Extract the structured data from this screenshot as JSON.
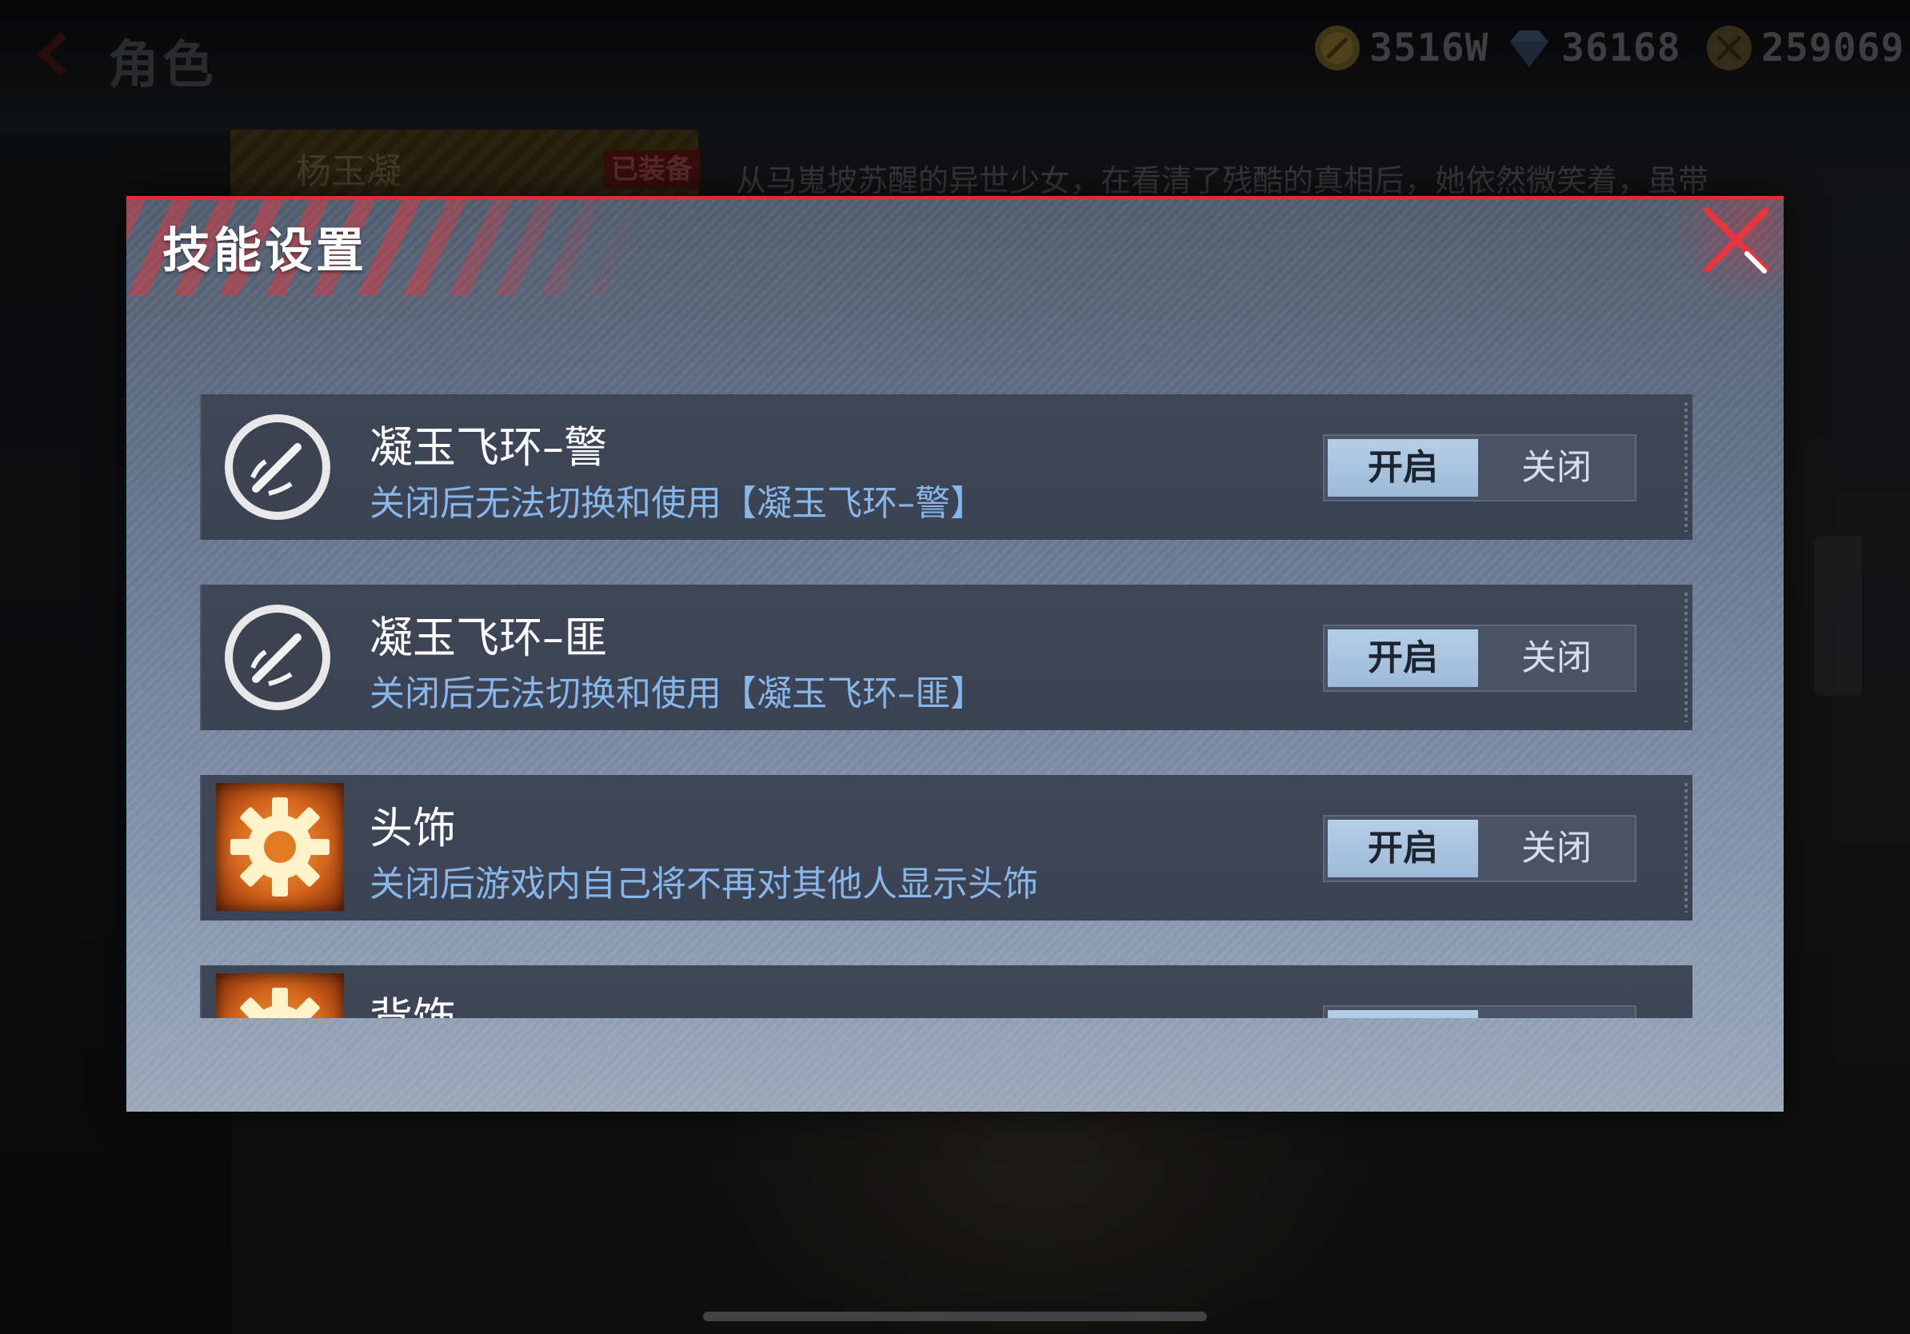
{
  "topbar": {
    "title": "角色",
    "currencies": [
      {
        "icon": "gold-coin-icon",
        "value": "3516W"
      },
      {
        "icon": "diamond-icon",
        "value": "36168"
      },
      {
        "icon": "medal-coin-icon",
        "value": "259069"
      }
    ]
  },
  "background": {
    "character_name": "杨玉凝",
    "equipped_badge": "已装备",
    "character_desc": "从马嵬坡苏醒的异世少女，在看清了残酷的真相后，她依然微笑着，虽带"
  },
  "modal": {
    "title": "技能设置",
    "skills": [
      {
        "name": "凝玉飞环–警",
        "desc": "关闭后无法切换和使用【凝玉飞环–警】",
        "icon": "dagger-skill-icon",
        "on_label": "开启",
        "off_label": "关闭",
        "state": "on"
      },
      {
        "name": "凝玉飞环–匪",
        "desc": "关闭后无法切换和使用【凝玉飞环–匪】",
        "icon": "dagger-skill-icon",
        "on_label": "开启",
        "off_label": "关闭",
        "state": "on"
      },
      {
        "name": "头饰",
        "desc": "关闭后游戏内自己将不再对其他人显示头饰",
        "icon": "gear-icon",
        "on_label": "开启",
        "off_label": "关闭",
        "state": "on"
      },
      {
        "name": "背饰",
        "desc": "",
        "icon": "gear-icon",
        "on_label": "",
        "off_label": "",
        "state": "on"
      }
    ]
  },
  "colors": {
    "accent_red": "#d93036",
    "desc_blue": "#88b6e8",
    "toggle_active": "#9dbad8"
  }
}
